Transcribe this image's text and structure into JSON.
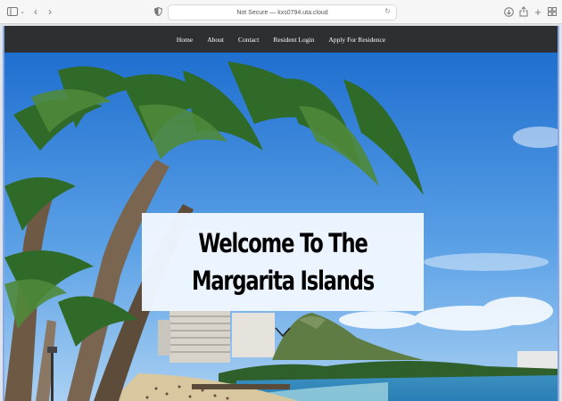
{
  "browser": {
    "address_text": "Not Secure — kxs0794.uta.cloud",
    "icons": [
      "sidebar-icon",
      "chevron-down-icon",
      "back-icon",
      "forward-icon",
      "shield-icon",
      "reload-icon",
      "download-icon",
      "share-icon",
      "new-tab-icon",
      "tabs-overview-icon"
    ]
  },
  "nav": {
    "items": [
      {
        "label": "Home"
      },
      {
        "label": "About"
      },
      {
        "label": "Contact"
      },
      {
        "label": "Resident Login"
      },
      {
        "label": "Apply For Residence"
      }
    ]
  },
  "hero": {
    "title": "Welcome To The Margarita Islands",
    "scroll_icon": "chevron-down-icon"
  },
  "colors": {
    "nav_background": "#2e2f30",
    "title_box": "#f0f7ff",
    "page_border": "#8aa7e6"
  }
}
